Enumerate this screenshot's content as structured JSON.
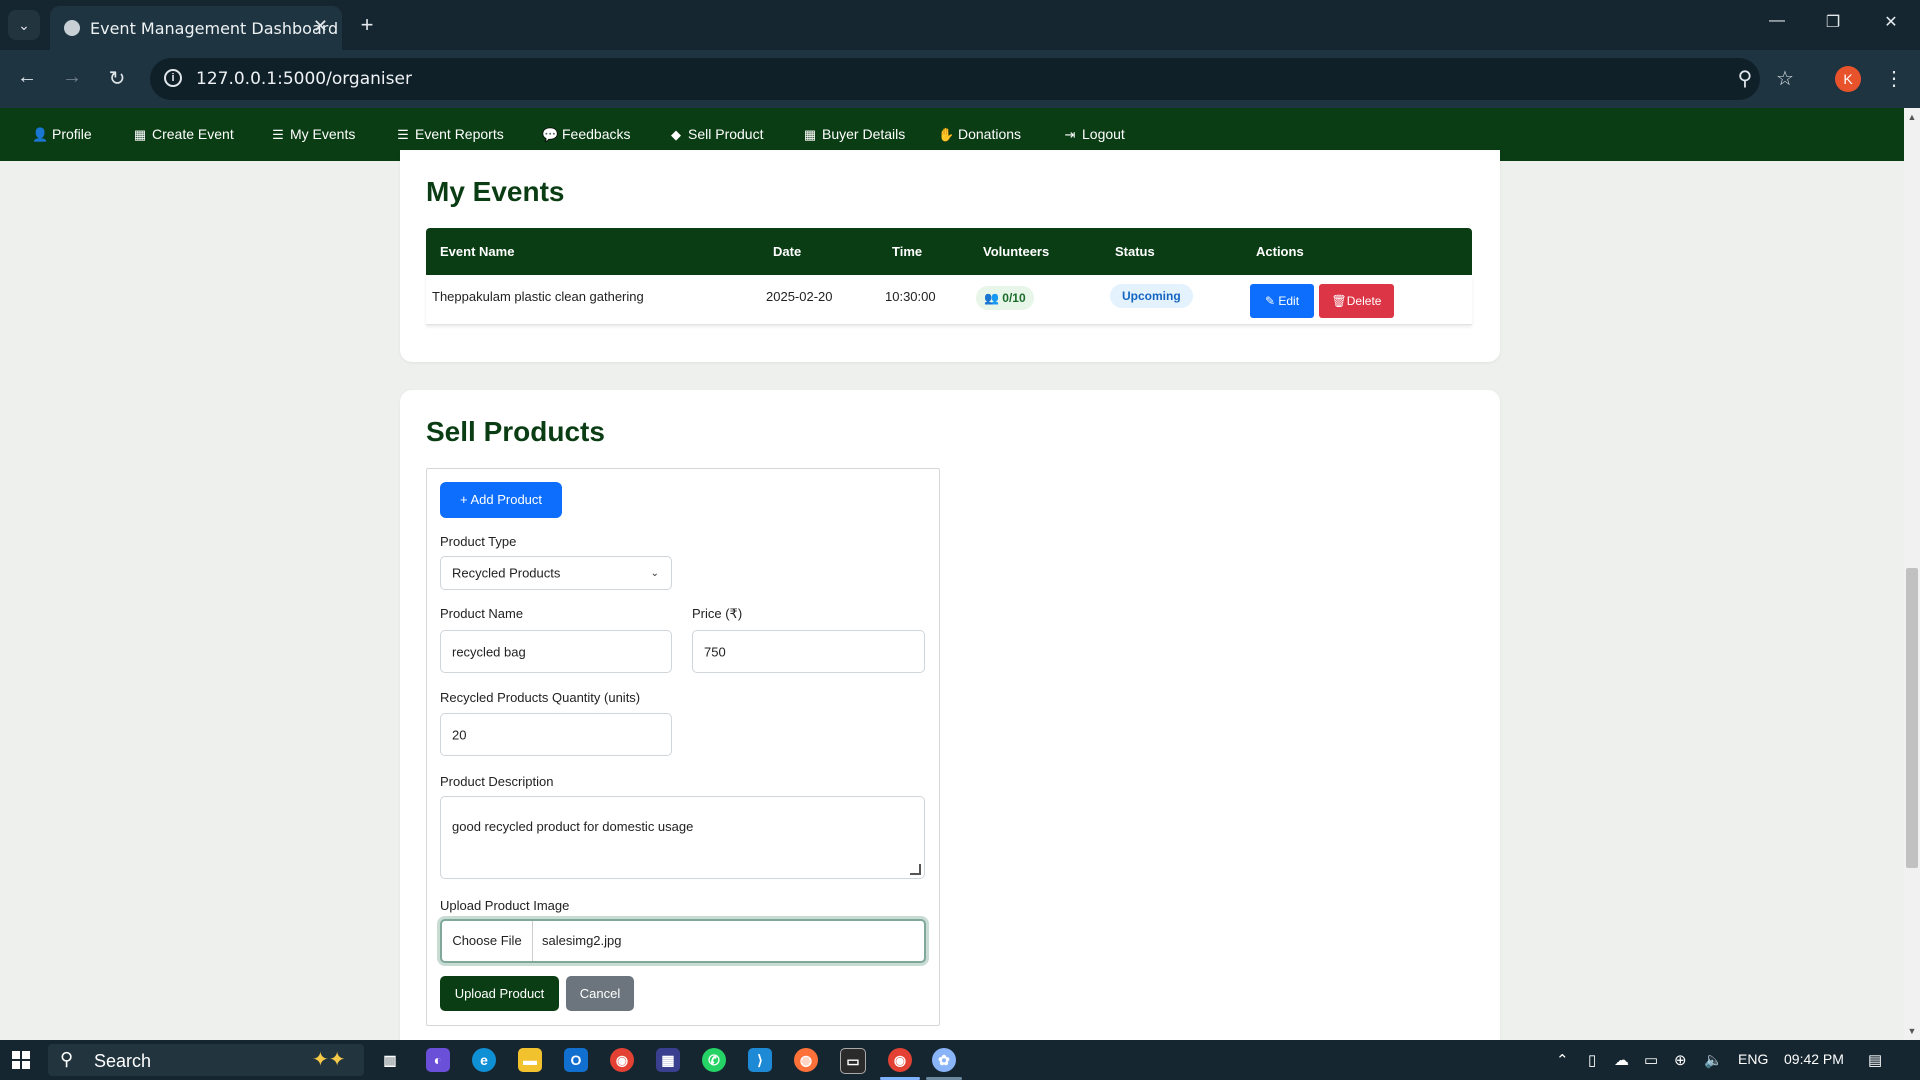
{
  "browser": {
    "tab_title": "Event Management Dashboard",
    "url": "127.0.0.1:5000/organiser",
    "profile_initial": "K"
  },
  "nav": {
    "items": [
      {
        "label": "Profile",
        "icon": "user-icon"
      },
      {
        "label": "Create Event",
        "icon": "calendar-plus-icon"
      },
      {
        "label": "My Events",
        "icon": "list-icon"
      },
      {
        "label": "Event Reports",
        "icon": "report-list-icon"
      },
      {
        "label": "Feedbacks",
        "icon": "comments-icon"
      },
      {
        "label": "Sell Product",
        "icon": "tag-icon"
      },
      {
        "label": "Buyer Details",
        "icon": "calendar-icon"
      },
      {
        "label": "Donations",
        "icon": "hand-holding-icon"
      },
      {
        "label": "Logout",
        "icon": "sign-out-icon"
      }
    ]
  },
  "events": {
    "title": "My Events",
    "columns": [
      "Event Name",
      "Date",
      "Time",
      "Volunteers",
      "Status",
      "Actions"
    ],
    "rows": [
      {
        "name": "Theppakulam plastic clean gathering",
        "date": "2025-02-20",
        "time": "10:30:00",
        "volunteers": "0/10",
        "status": "Upcoming",
        "edit": "Edit",
        "delete": "Delete"
      }
    ]
  },
  "sell": {
    "title": "Sell Products",
    "add_button": "Add Product",
    "product_type_label": "Product Type",
    "product_type_value": "Recycled Products",
    "product_name_label": "Product Name",
    "product_name_value": "recycled bag",
    "price_label": "Price (₹)",
    "price_value": "750",
    "quantity_label": "Recycled Products Quantity (units)",
    "quantity_value": "20",
    "description_label": "Product Description",
    "description_value": "good recycled product for domestic usage",
    "image_label": "Upload Product Image",
    "choose_file": "Choose File",
    "file_name": "salesimg2.jpg",
    "upload_button": "Upload Product",
    "cancel_button": "Cancel"
  },
  "taskbar": {
    "search_placeholder": "Search",
    "language": "ENG",
    "time": "09:42 PM"
  },
  "colors": {
    "brand_green": "#0b3d14",
    "primary": "#0d6efd",
    "danger": "#dc3545"
  }
}
